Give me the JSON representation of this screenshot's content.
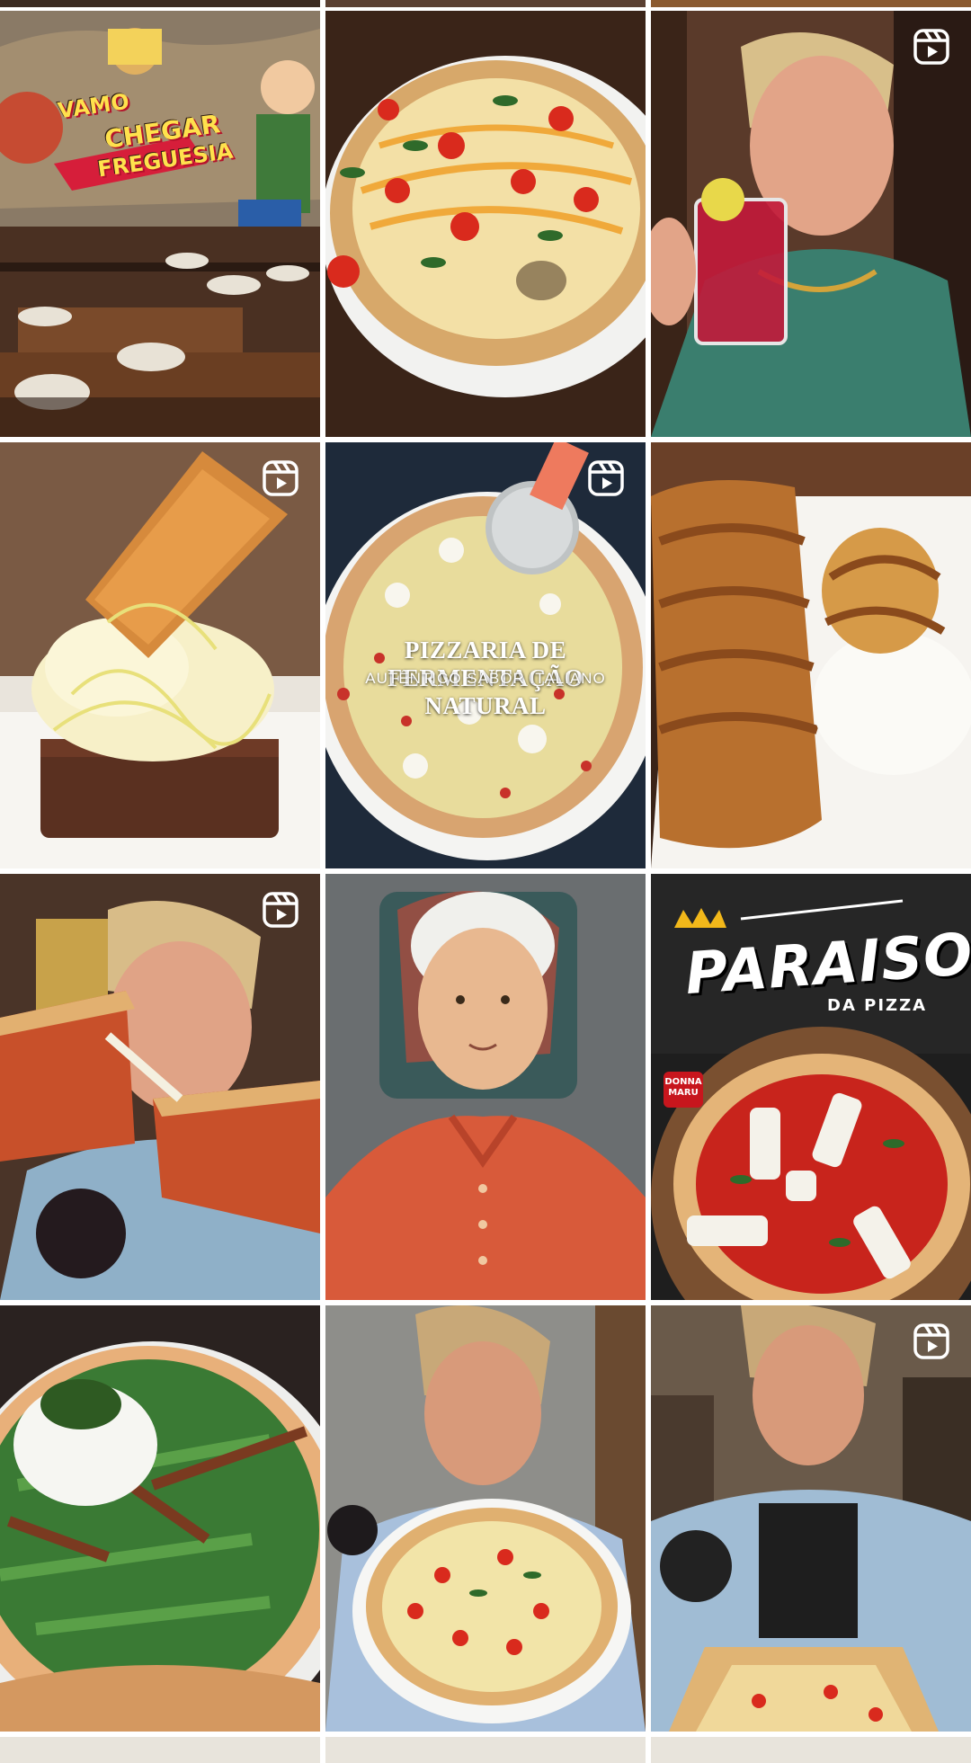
{
  "feed": {
    "background": "#ffffff",
    "tiles": [
      {
        "kind": "image",
        "subject": "restaurant-mural"
      },
      {
        "kind": "image",
        "subject": "margherita-pizza"
      },
      {
        "kind": "reel",
        "subject": "woman-drinking"
      },
      {
        "kind": "reel",
        "subject": "dessert-brownie"
      },
      {
        "kind": "reel",
        "subject": "white-pizza-cutting"
      },
      {
        "kind": "image",
        "subject": "caramel-calzone"
      },
      {
        "kind": "reel",
        "subject": "woman-cheese-pull"
      },
      {
        "kind": "image",
        "subject": "grandma-illustration"
      },
      {
        "kind": "image",
        "subject": "paraiso-pizza-promo"
      },
      {
        "kind": "image",
        "subject": "burrata-pizza"
      },
      {
        "kind": "image",
        "subject": "woman-holding-pizza"
      },
      {
        "kind": "reel",
        "subject": "woman-pizza-table"
      }
    ]
  },
  "mural": {
    "line1": "VAMO",
    "line2": "CHEGAR",
    "line3": "FREGUESIA"
  },
  "white_pizza_overlay": {
    "title": "PIZZARIA DE FERMENTAÇÃO NATURAL",
    "subtitle": "AUTÊNTICO SABOR ITALIANO"
  },
  "paraiso": {
    "title": "PARAISO",
    "subtitle": "DA PIZZA",
    "badge": "DONNA MARU"
  },
  "icons": {
    "reel": "reels-icon"
  },
  "colors": {
    "gap": "#ffffff",
    "reel_icon": "#ffffff"
  }
}
